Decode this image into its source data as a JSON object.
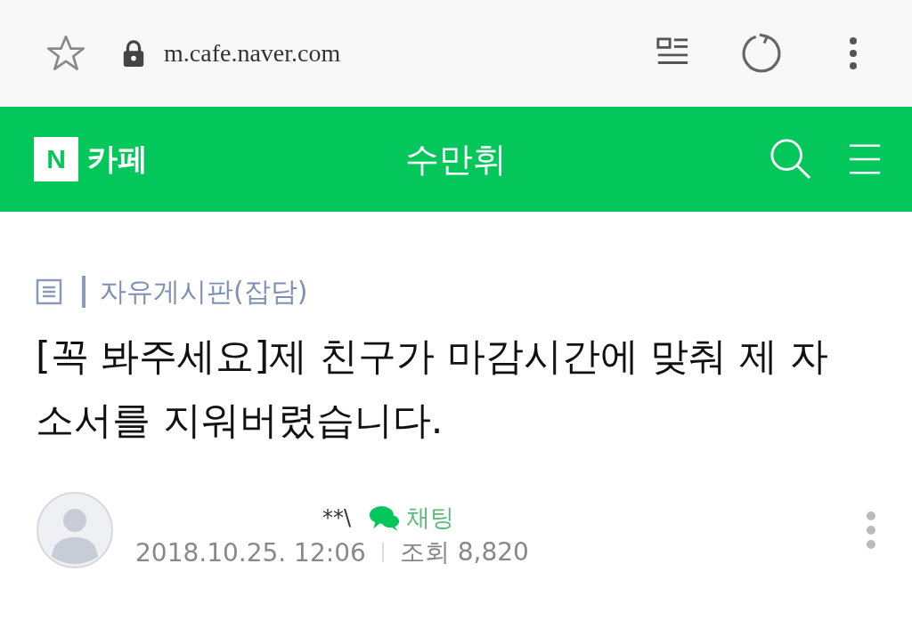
{
  "browser": {
    "url": "m.cafe.naver.com"
  },
  "header": {
    "logo_letter": "N",
    "service": "카페",
    "cafe_name": "수만휘"
  },
  "post": {
    "board": "자유게시판(잡담)",
    "title": "[꼭 봐주세요]제 친구가 마감시간에 맞춰 제 자소서를 지워버렸습니다.",
    "author": "**\\",
    "chat_label": "채팅",
    "date": "2018.10.25. 12:06",
    "views": "조회 8,820"
  }
}
